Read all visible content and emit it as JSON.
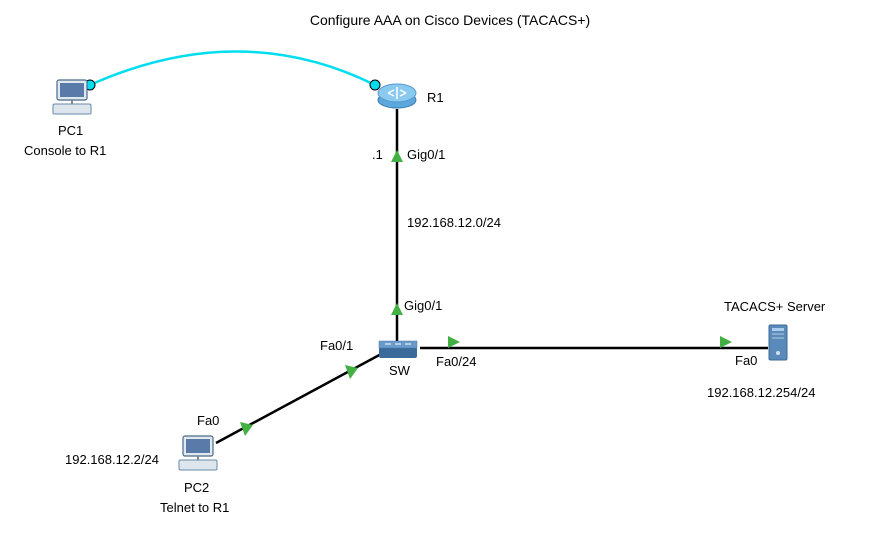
{
  "title": "Configure AAA on Cisco Devices (TACACS+)",
  "devices": {
    "pc1": {
      "name": "PC1",
      "subtitle": "Console to R1"
    },
    "pc2": {
      "name": "PC2",
      "subtitle": "Telnet to R1",
      "ip": "192.168.12.2/24"
    },
    "r1": {
      "name": "R1",
      "interface_ip": ".1"
    },
    "sw": {
      "name": "SW"
    },
    "tacacs": {
      "name": "TACACS+ Server",
      "ip": "192.168.12.254/24"
    }
  },
  "links": {
    "r1_sw": {
      "network": "192.168.12.0/24",
      "r1_port": "Gig0/1",
      "sw_port": "Gig0/1"
    },
    "sw_pc2": {
      "sw_port": "Fa0/1",
      "pc2_port": "Fa0"
    },
    "sw_tacacs": {
      "sw_port": "Fa0/24",
      "tacacs_port": "Fa0"
    }
  }
}
